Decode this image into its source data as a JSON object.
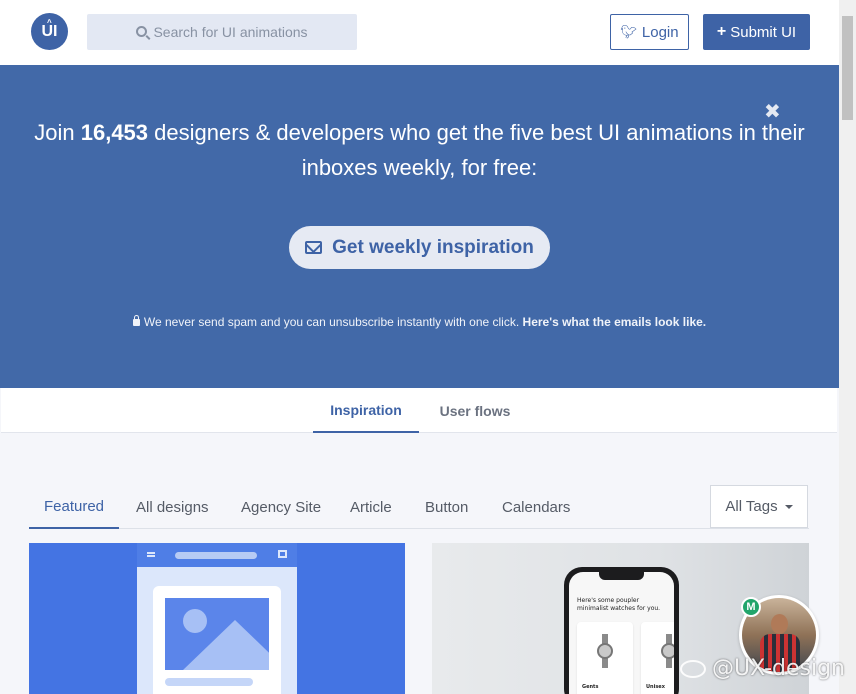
{
  "header": {
    "logo_text": "UI",
    "search_placeholder": "Search for UI animations",
    "login_label": "Login",
    "submit_label": "Submit UI"
  },
  "banner": {
    "headline_pre": "Join ",
    "headline_count": "16,453",
    "headline_post": " designers & developers who get the five best UI animations in their inboxes weekly, for free:",
    "cta_label": "Get weekly inspiration",
    "note_text": "We never send spam and you can unsubscribe instantly with one click. ",
    "note_link": "Here's what the emails look like.",
    "close_glyph": "✖"
  },
  "top_tabs": [
    {
      "label": "Inspiration",
      "active": true
    },
    {
      "label": "User flows",
      "active": false
    }
  ],
  "filter_tabs": [
    {
      "label": "Featured",
      "active": true
    },
    {
      "label": "All designs",
      "active": false
    },
    {
      "label": "Agency Site",
      "active": false
    },
    {
      "label": "Article",
      "active": false
    },
    {
      "label": "Button",
      "active": false
    },
    {
      "label": "Calendars",
      "active": false
    }
  ],
  "tags_dropdown": {
    "label": "All Tags"
  },
  "cards": [
    {
      "kind": "blue-mockup"
    },
    {
      "kind": "phone-mockup",
      "screen_title": "Here's some poupler minimalist watches for you.",
      "items": [
        "Gents",
        "Unisex"
      ]
    }
  ],
  "avatar": {
    "badge": "M"
  },
  "watermark": "@UX-design",
  "colors": {
    "brand": "#3e63a6",
    "banner_bg": "#4269a8",
    "search_bg": "#e3e8f3",
    "page_bg": "#f5f6fa"
  }
}
